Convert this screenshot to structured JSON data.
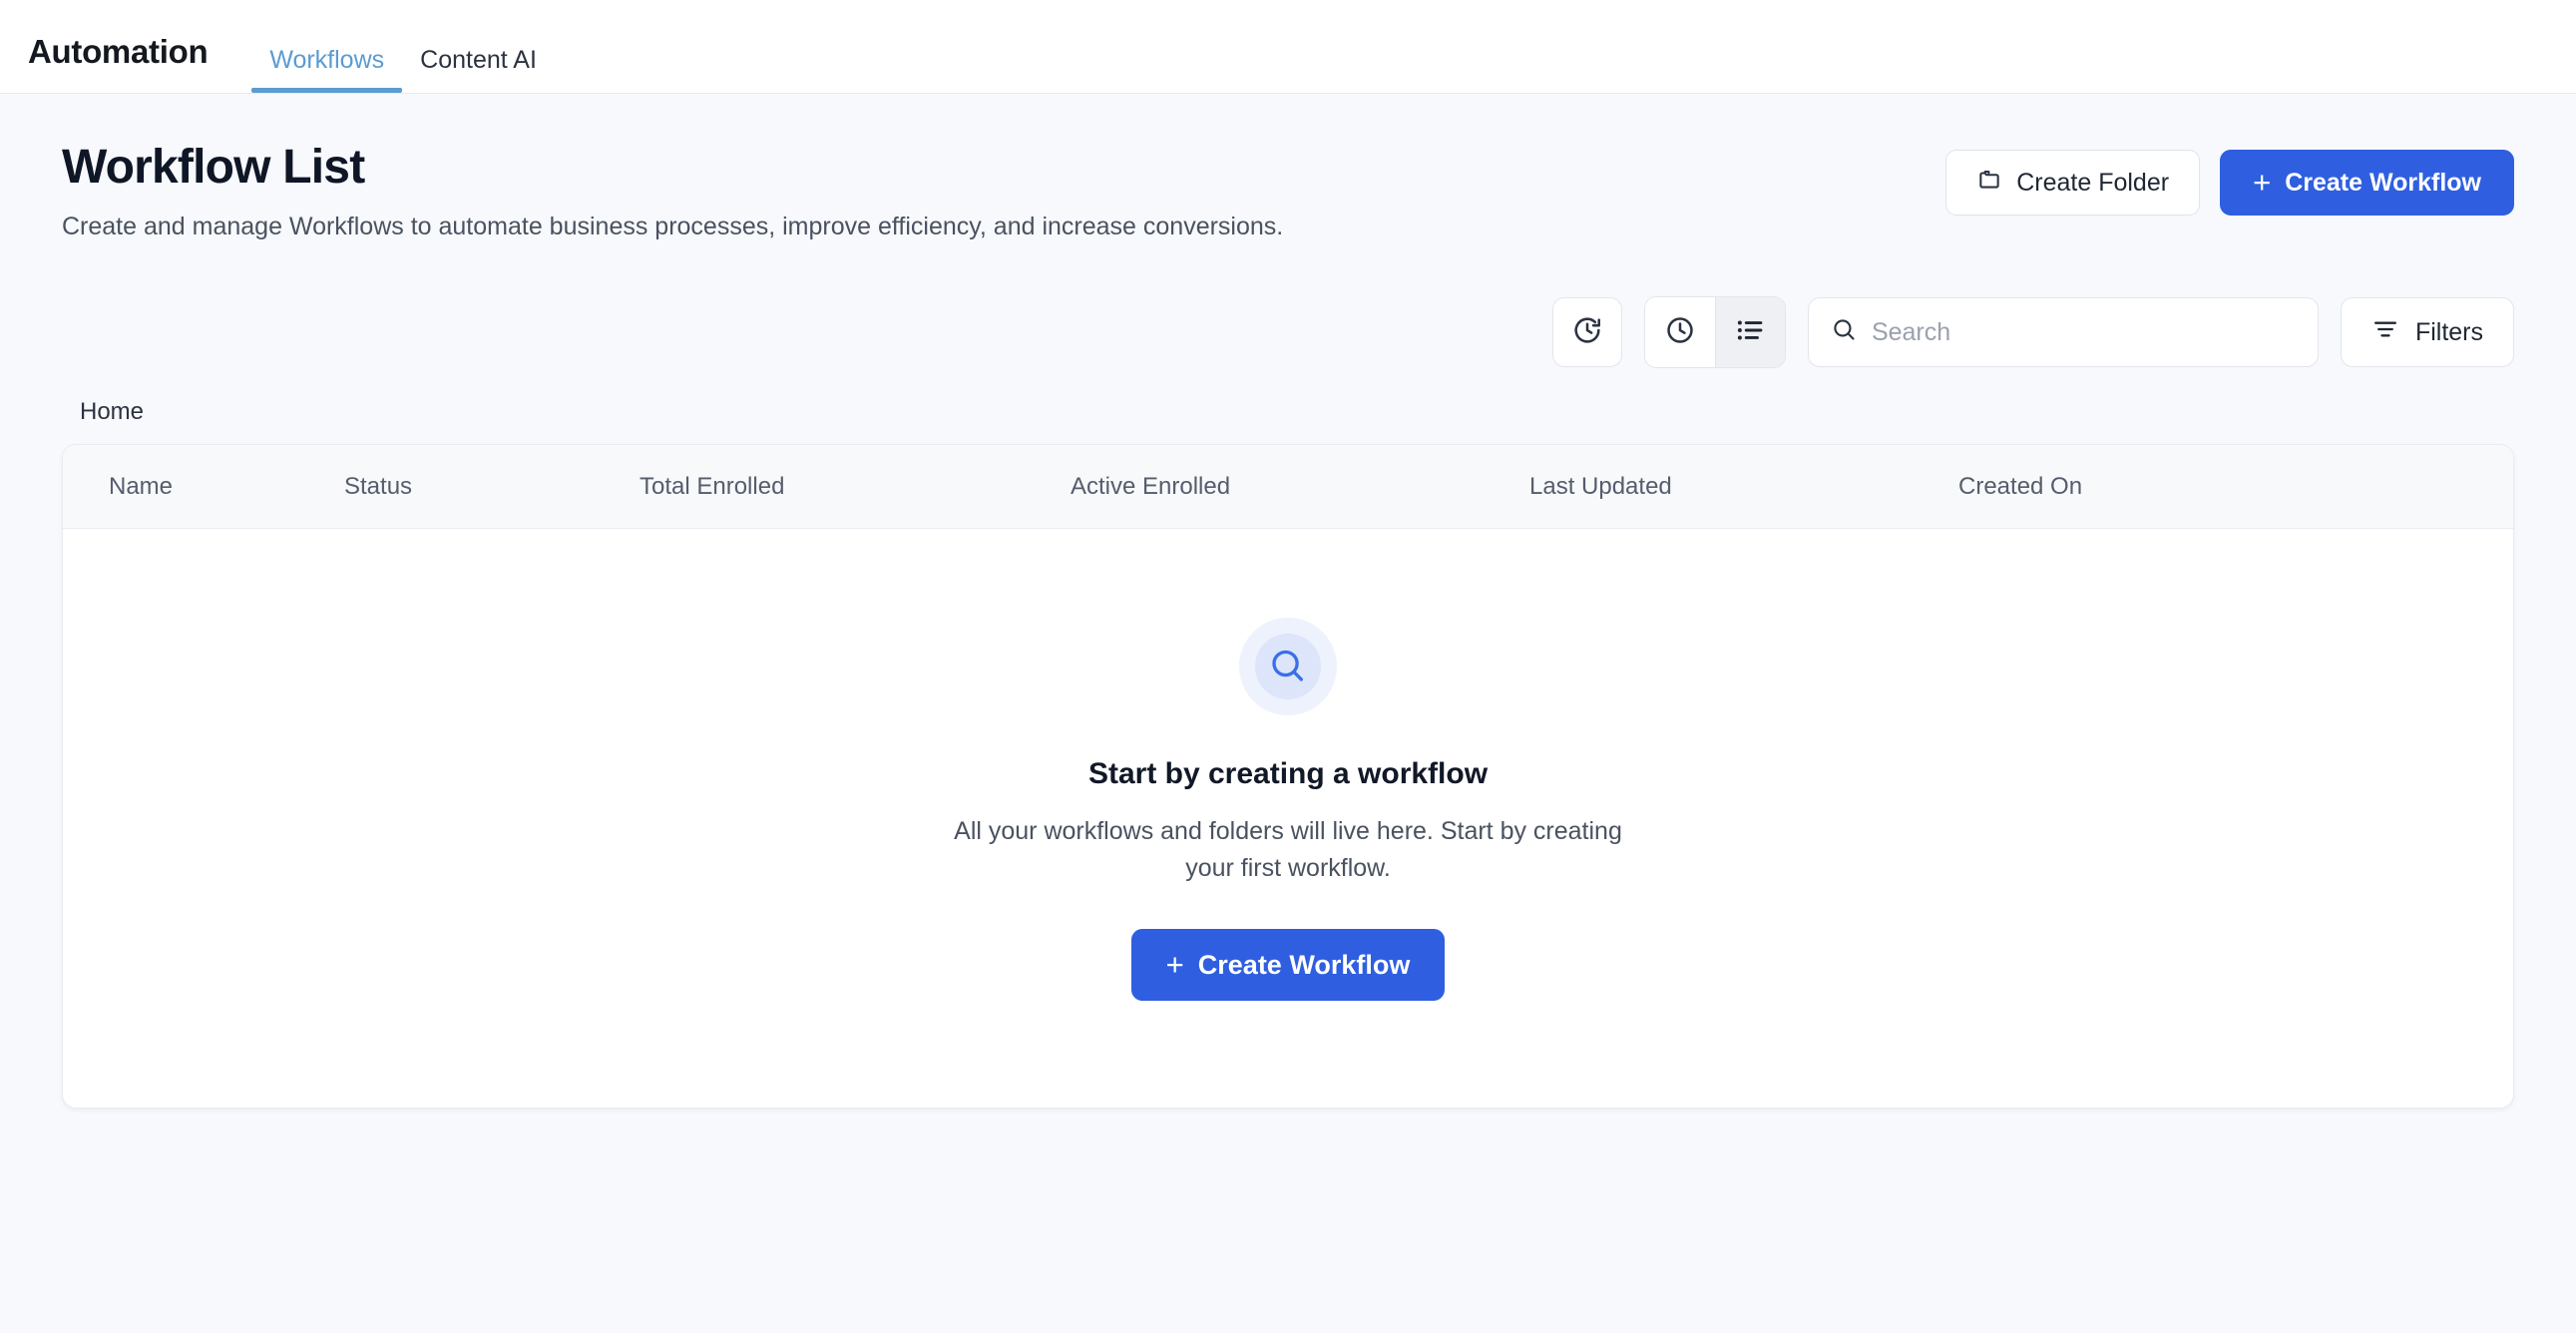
{
  "topbar": {
    "app_title": "Automation",
    "tabs": [
      {
        "label": "Workflows",
        "active": true
      },
      {
        "label": "Content AI",
        "active": false
      }
    ],
    "active_tab_color": "#5b9bd1"
  },
  "page": {
    "title": "Workflow List",
    "subtitle": "Create and manage Workflows to automate business processes, improve efficiency, and increase conversions.",
    "actions": {
      "create_folder_label": "Create Folder",
      "create_folder_icon": "folder-icon",
      "create_workflow_label": "Create Workflow",
      "create_workflow_icon": "plus-icon",
      "primary_color": "#2f5fe0"
    }
  },
  "toolbar": {
    "history_restore_icon": "clock-arrow-icon",
    "recent_icon": "clock-icon",
    "list_view_icon": "list-icon",
    "list_view_selected": true,
    "search": {
      "icon": "search-icon",
      "value": "",
      "placeholder": "Search"
    },
    "filters": {
      "label": "Filters",
      "icon": "filter-lines-icon"
    }
  },
  "breadcrumb": {
    "items": [
      "Home"
    ]
  },
  "table": {
    "columns": [
      "Name",
      "Status",
      "Total Enrolled",
      "Active Enrolled",
      "Last Updated",
      "Created On"
    ],
    "rows": []
  },
  "empty_state": {
    "icon": "search-circle-icon",
    "icon_color": "#3b6ee8",
    "title": "Start by creating a workflow",
    "description": "All your workflows and folders will live here. Start by creating your first workflow.",
    "cta_label": "Create Workflow",
    "cta_icon": "plus-icon"
  }
}
